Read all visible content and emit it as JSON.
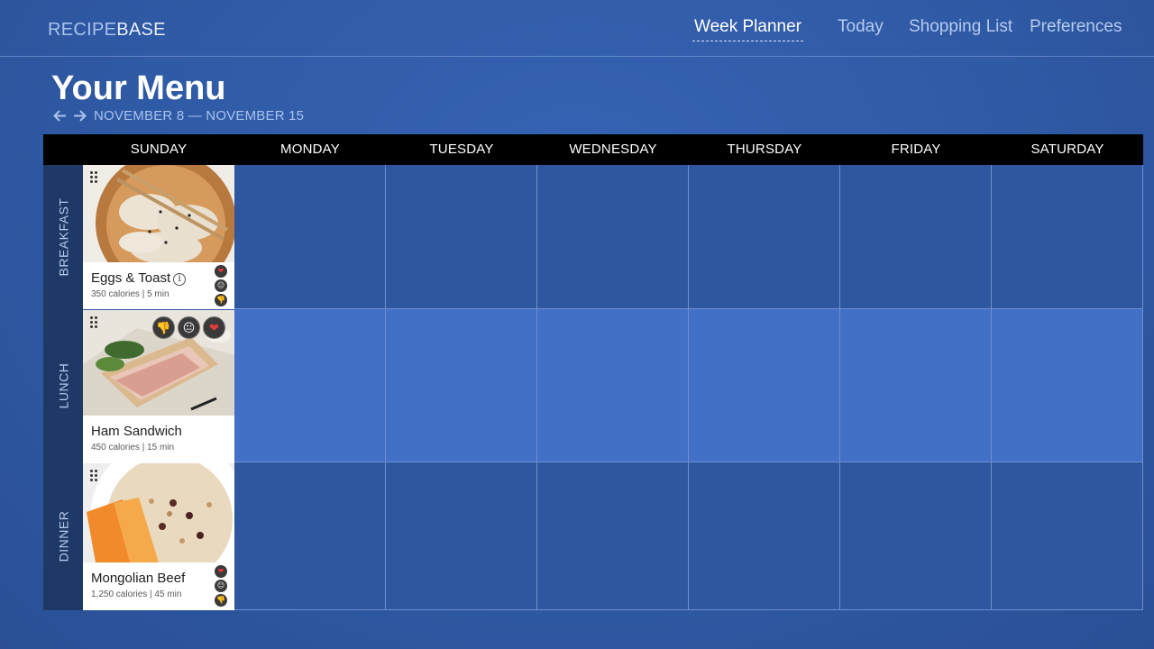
{
  "app": {
    "logo_part1": "RECIPE",
    "logo_part2": "BASE"
  },
  "nav": {
    "items": [
      {
        "label": "Week Planner",
        "active": true
      },
      {
        "label": "Today",
        "active": false
      },
      {
        "label": "Shopping List",
        "active": false
      },
      {
        "label": "Preferences",
        "active": false
      }
    ]
  },
  "page": {
    "title": "Your Menu",
    "date_range": "NOVEMBER 8 — NOVEMBER 15",
    "prev_icon": "arrow-left-icon",
    "next_icon": "arrow-right-icon"
  },
  "days": [
    "SUNDAY",
    "MONDAY",
    "TUESDAY",
    "WEDNESDAY",
    "THURSDAY",
    "FRIDAY",
    "SATURDAY"
  ],
  "meals": [
    "BREAKFAST",
    "LUNCH",
    "DINNER"
  ],
  "cards": {
    "breakfast": {
      "name": "Eggs & Toast",
      "meta": "350 calories | 5 min",
      "info_icon": "info-icon"
    },
    "lunch": {
      "name": "Ham Sandwich",
      "meta": "450 calories | 15 min"
    },
    "dinner": {
      "name": "Mongolian Beef",
      "meta": "1,250 calories | 45 min"
    }
  },
  "reactions": {
    "icons": [
      "heart-icon",
      "neutral-face-icon",
      "thumbs-down-icon"
    ],
    "glyphs": {
      "heart": "❤",
      "neutral": "😐",
      "thumbs_down": "👎"
    }
  },
  "colors": {
    "background": "#3663b4",
    "header_bar": "#000000",
    "lunch_row": "#4270c6",
    "meal_column": "#1e3966"
  }
}
